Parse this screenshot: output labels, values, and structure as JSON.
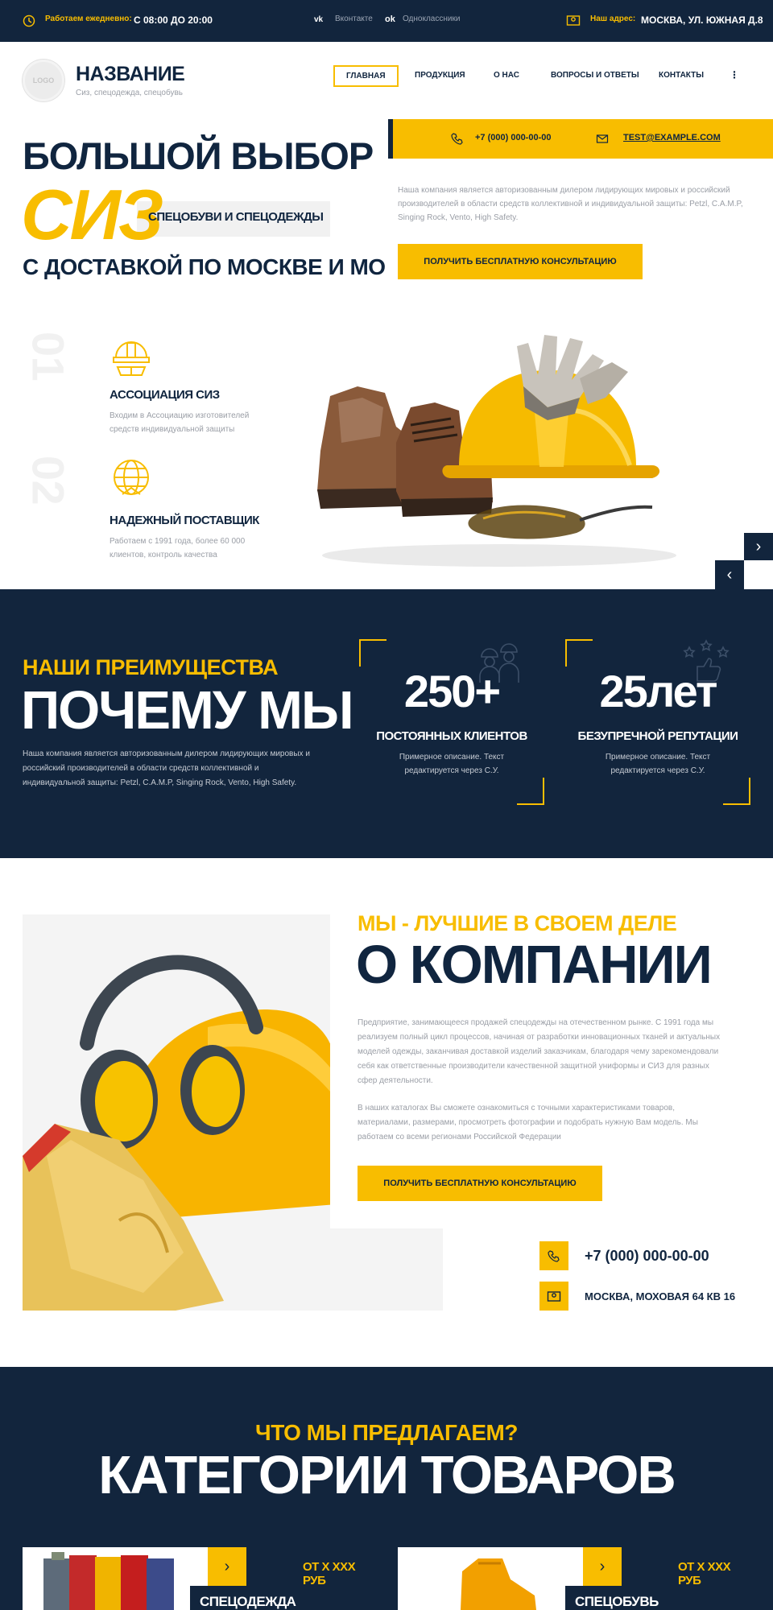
{
  "topbar": {
    "hours_label": "Работаем ежедневно:",
    "hours_value": "С 08:00 ДО 20:00",
    "social": [
      "Вконтакте",
      "Одноклассники"
    ],
    "address_label": "Наш адрес:",
    "address_value": "МОСКВА, УЛ. ЮЖНАЯ Д.8"
  },
  "header": {
    "logo": "LOGO",
    "title": "НАЗВАНИЕ",
    "subtitle": "Сиз, спецодежда, спецобувь",
    "nav": [
      "ГЛАВНАЯ",
      "ПРОДУКЦИЯ",
      "О НАС",
      "ВОПРОСЫ И ОТВЕТЫ",
      "КОНТАКТЫ"
    ],
    "more": "⋮"
  },
  "hero": {
    "line1": "БОЛЬШОЙ ВЫБОР",
    "big": "СИЗ",
    "tag": "СПЕЦОБУВИ И СПЕЦОДЕЖДЫ",
    "line3": "С ДОСТАВКОЙ ПО МОСКВЕ И МО",
    "phone": "+7 (000) 000-00-00",
    "email": "TEST@EXAMPLE.COM",
    "text": "Наша компания является авторизованным дилером лидирующих мировых и российский производителей в области средств коллективной и индивидуальной защиты: Petzl, C.A.M.P, Singing Rock, Vento, High Safety.",
    "button": "ПОЛУЧИТЬ БЕСПЛАТНУЮ КОНСУЛЬТАЦИЮ",
    "features": [
      {
        "num": "01",
        "title": "АССОЦИАЦИЯ СИЗ",
        "text": "Входим в Ассоциацию изготовителей средств индивидуальной защиты"
      },
      {
        "num": "02",
        "title": "НАДЕЖНЫЙ ПОСТАВЩИК",
        "text": "Работаем с 1991 года, более 60 000 клиентов, контроль качества"
      }
    ],
    "next": "›",
    "prev": "‹"
  },
  "why": {
    "kicker": "НАШИ ПРЕИМУЩЕСТВА",
    "title": "ПОЧЕМУ МЫ",
    "text": "Наша компания является авторизованным дилером лидирующих мировых и российский производителей в области средств коллективной и индивидуальной защиты: Petzl, C.A.M.P, Singing Rock, Vento, High Safety.",
    "stats": [
      {
        "value": "250+",
        "title": "ПОСТОЯННЫХ КЛИЕНТОВ",
        "text": "Примерное описание. Текст редактируется через С.У."
      },
      {
        "value": "25лет",
        "title": "БЕЗУПРЕЧНОЙ РЕПУТАЦИИ",
        "text": "Примерное описание. Текст редактируется через С.У."
      }
    ]
  },
  "about": {
    "kicker": "МЫ - ЛУЧШИЕ В СВОЕМ ДЕЛЕ",
    "title": "О КОМПАНИИ",
    "p1": "Предприятие, занимающееся продажей спецодежды на отечественном рынке. С 1991 года мы реализуем полный цикл процессов, начиная от разработки инновационных тканей и актуальных моделей одежды, заканчивая доставкой изделий заказчикам, благодаря чему зарекомендовали себя как ответственные производители качественной защитной униформы и СИЗ для разных сфер деятельности.",
    "p2": "В наших каталогах Вы сможете ознакомиться с точными характеристиками товаров, материалами, размерами, просмотреть фотографии и подобрать нужную Вам модель. Мы работаем со всеми регионами Российской Федерации",
    "button": "ПОЛУЧИТЬ БЕСПЛАТНУЮ КОНСУЛЬТАЦИЮ",
    "phone": "+7 (000) 000-00-00",
    "address": "МОСКВА, МОХОВАЯ 64 КВ 16"
  },
  "categories": {
    "kicker": "ЧТО МЫ ПРЕДЛАГАЕМ?",
    "title": "КАТЕГОРИИ ТОВАРОВ",
    "items": [
      {
        "price": "ОТ Х ХХХ РУБ",
        "name": "СПЕЦОДЕЖДА"
      },
      {
        "price": "ОТ Х ХХХ РУБ",
        "name": "СПЕЦОБУВЬ"
      }
    ],
    "arrow": "›"
  },
  "colors": {
    "navy": "#12253d",
    "accent": "#f8bd00"
  }
}
